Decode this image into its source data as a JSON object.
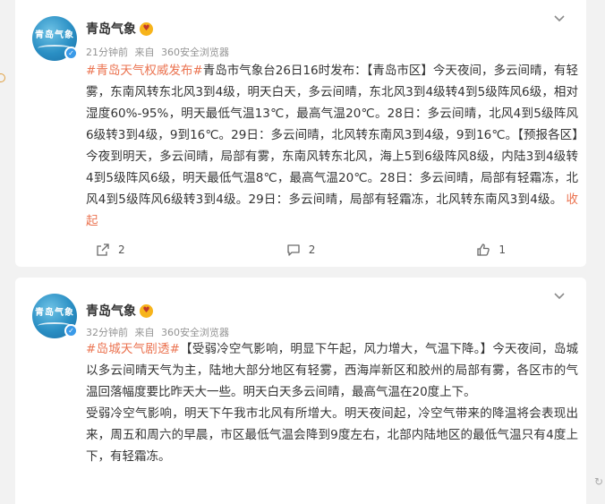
{
  "colors": {
    "accent": "#eb7350",
    "meta": "#939393",
    "text": "#333333",
    "verified": "#3a9ae8"
  },
  "posts": [
    {
      "author": "青岛气象",
      "avatar_text": "青岛气象",
      "time": "21分钟前",
      "source_prefix": "来自",
      "source": "360安全浏览器",
      "topic": "#青岛天气权威发布#",
      "text": "青岛市气象台26日16时发布：【青岛市区】今天夜间，多云间晴，有轻雾，东南风转东北风3到4级，明天白天，多云间晴，东北风3到4级转4到5级阵风6级，相对湿度60%-95%，明天最低气温13℃，最高气温20℃。28日：多云间晴，北风4到5级阵风6级转3到4级，9到16℃。29日：多云间晴，北风转东南风3到4级，9到16℃。【预报各区】今夜到明天，多云间晴，局部有雾，东南风转东北风，海上5到6级阵风8级，内陆3到4级转4到5级阵风6级，明天最低气温8℃，最高气温20℃。28日：多云间晴，局部有轻霜冻，北风4到5级阵风6级转3到4级。29日：多云间晴，局部有轻霜冻，北风转东南风3到4级。",
      "collapse_label": "收起",
      "actions": {
        "repost": "2",
        "comment": "2",
        "like": "1"
      }
    },
    {
      "author": "青岛气象",
      "avatar_text": "青岛气象",
      "time": "32分钟前",
      "source_prefix": "来自",
      "source": "360安全浏览器",
      "topic": "#岛城天气剧透#",
      "text": "【受弱冷空气影响，明显下午起，风力增大，气温下降。】今天夜间，岛城以多云间晴天气为主，陆地大部分地区有轻雾，西海岸新区和胶州的局部有雾，各区市的气温回落幅度要比昨天大一些。明天白天多云间晴，最高气温在20度上下。",
      "paragraph2": "受弱冷空气影响，明天下午我市北风有所增大。明天夜间起，冷空气带来的降温将会表现出来，周五和周六的早晨，市区最低气温会降到9度左右，北部内陆地区的最低气温只有4度上下，有轻霜冻。"
    }
  ]
}
